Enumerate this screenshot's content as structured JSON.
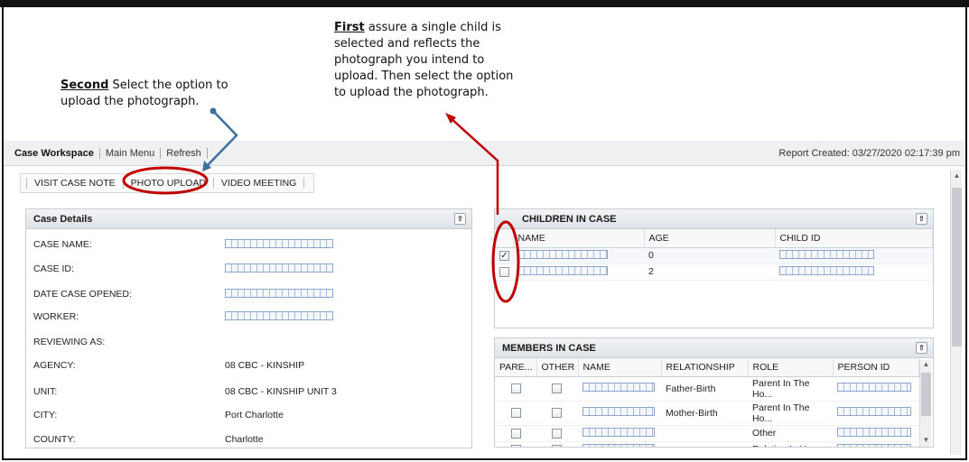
{
  "callouts": {
    "first": {
      "emphasis": "First",
      "lines": [
        " assure a single child is",
        "selected and reflects the",
        "photograph you intend to",
        "upload. Then select the option",
        "to upload the photograph."
      ]
    },
    "second": {
      "emphasis": "Second",
      "lines": [
        " Select the option to",
        "upload the photograph."
      ]
    }
  },
  "app_bar": {
    "nav": [
      "Case Workspace",
      "Main Menu",
      "Refresh"
    ],
    "report": "Report Created: 03/27/2020 02:17:39 pm"
  },
  "tabs": [
    "VISIT CASE NOTE",
    "PHOTO UPLOAD",
    "VIDEO MEETING"
  ],
  "case_details": {
    "title": "Case Details",
    "rows": [
      {
        "label": "CASE NAME:",
        "value": ""
      },
      {
        "label": "CASE ID:",
        "value": ""
      },
      {
        "label": "DATE CASE OPENED:",
        "value": ""
      },
      {
        "label": "WORKER:",
        "value": ""
      },
      {
        "label": "REVIEWING AS:",
        "value": ""
      },
      {
        "label": "AGENCY:",
        "value": "08 CBC - KINSHIP"
      },
      {
        "label": "UNIT:",
        "value": "08 CBC - KINSHIP UNIT 3"
      },
      {
        "label": "CITY:",
        "value": "Port Charlotte"
      },
      {
        "label": "COUNTY:",
        "value": "Charlotte"
      }
    ]
  },
  "children": {
    "title": "CHILDREN IN CASE",
    "columns": [
      "NAME",
      "AGE",
      "CHILD ID"
    ],
    "rows": [
      {
        "checked": true,
        "age": "0"
      },
      {
        "checked": false,
        "age": "2"
      }
    ]
  },
  "members": {
    "title": "MEMBERS IN CASE",
    "columns": [
      "PARE...",
      "OTHER",
      "NAME",
      "RELATIONSHIP",
      "ROLE",
      "PERSON ID"
    ],
    "rows": [
      {
        "relationship": "Father-Birth",
        "role": "Parent In The Ho..."
      },
      {
        "relationship": "Mother-Birth",
        "role": "Parent In The Ho..."
      },
      {
        "relationship": "",
        "role": "Other"
      },
      {
        "relationship": "",
        "role": "Relative In Home"
      }
    ]
  },
  "colors": {
    "annotation_red": "#c00000",
    "annotation_blue": "#3f6f9f"
  }
}
